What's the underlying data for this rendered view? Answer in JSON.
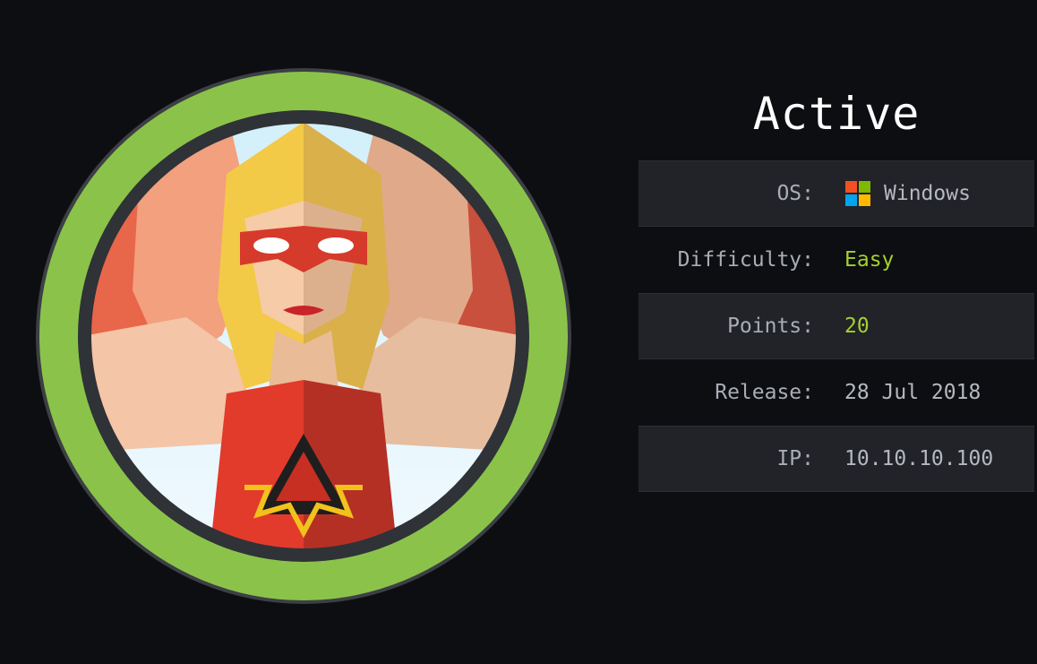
{
  "machine": {
    "name": "Active"
  },
  "info": [
    {
      "key": "OS:",
      "value": "Windows",
      "icon": "windows-logo-icon"
    },
    {
      "key": "Difficulty:",
      "value": "Easy",
      "color": "#a4d02e"
    },
    {
      "key": "Points:",
      "value": "20",
      "color": "#a4d02e"
    },
    {
      "key": "Release:",
      "value": "28 Jul 2018"
    },
    {
      "key": "IP:",
      "value": "10.10.10.100"
    }
  ],
  "colors": {
    "background": "#0d0e11",
    "ring": "#8bc34a",
    "accent_green": "#a4d02e",
    "row_shade": "#212328"
  }
}
